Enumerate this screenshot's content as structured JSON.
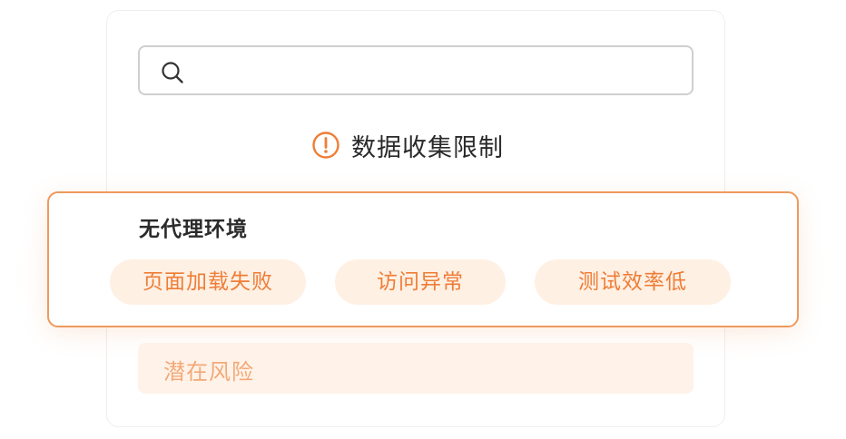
{
  "search": {
    "icon": "search-icon",
    "value": "",
    "placeholder": ""
  },
  "notice": {
    "icon": "exclamation-circle-icon",
    "text": "数据收集限制",
    "color": "#ef7d36"
  },
  "card": {
    "title": "无代理环境",
    "border_color": "#ee9a5e",
    "tags": [
      {
        "label": "页面加载失败"
      },
      {
        "label": "访问异常"
      },
      {
        "label": "测试效率低"
      }
    ]
  },
  "risk": {
    "text": "潜在风险"
  },
  "colors": {
    "accent": "#ef7d36",
    "tag_bg": "#fff0e4",
    "risk_bg": "#fff2e8",
    "risk_text": "#f2a978"
  }
}
